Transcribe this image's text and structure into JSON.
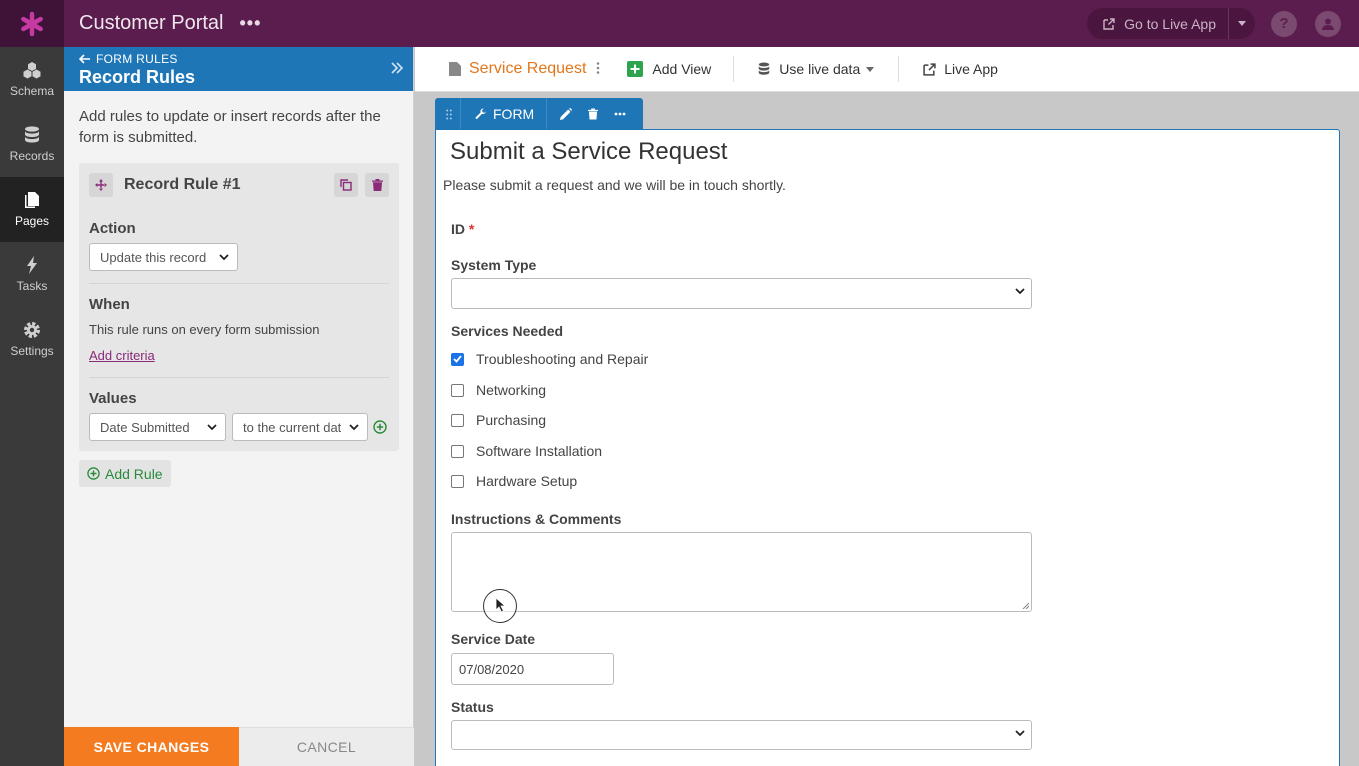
{
  "app": {
    "title": "Customer Portal",
    "more_label": "•••"
  },
  "topbar": {
    "live_app_label": "Go to Live App",
    "help_label": "?"
  },
  "nav": {
    "items": [
      {
        "label": "Schema",
        "icon": "schema-icon"
      },
      {
        "label": "Records",
        "icon": "database-icon"
      },
      {
        "label": "Pages",
        "icon": "pages-icon",
        "active": true
      },
      {
        "label": "Tasks",
        "icon": "lightning-icon"
      },
      {
        "label": "Settings",
        "icon": "gear-icon"
      }
    ]
  },
  "panel": {
    "crumb": "FORM RULES",
    "title": "Record Rules",
    "description": "Add rules to update or insert records after the form is submitted.",
    "rule": {
      "title": "Record Rule #1",
      "action_label": "Action",
      "action_value": "Update this record",
      "when_label": "When",
      "when_text": "This rule runs on every form submission",
      "add_criteria": "Add criteria",
      "values_label": "Values",
      "value_field": "Date Submitted",
      "value_target": "to the current dat"
    },
    "add_rule": "Add Rule",
    "save": "SAVE CHANGES",
    "cancel": "CANCEL"
  },
  "toolbar": {
    "page_name": "Service Request",
    "add_view": "Add View",
    "live_data": "Use live data",
    "live_app": "Live App"
  },
  "form": {
    "tab_label": "FORM",
    "title": "Submit a Service Request",
    "subtitle": "Please submit a request and we will be in touch shortly.",
    "id_label": "ID",
    "required_mark": "*",
    "system_type_label": "System Type",
    "services_label": "Services Needed",
    "services": [
      {
        "label": "Troubleshooting and Repair",
        "checked": true
      },
      {
        "label": "Networking",
        "checked": false
      },
      {
        "label": "Purchasing",
        "checked": false
      },
      {
        "label": "Software Installation",
        "checked": false
      },
      {
        "label": "Hardware Setup",
        "checked": false
      }
    ],
    "instructions_label": "Instructions & Comments",
    "service_date_label": "Service Date",
    "service_date_value": "07/08/2020",
    "status_label": "Status"
  },
  "colors": {
    "topbar": "#5a1d4e",
    "panel_header": "#1e76b7",
    "save": "#f47b20",
    "accent_link": "#8a2a78"
  }
}
